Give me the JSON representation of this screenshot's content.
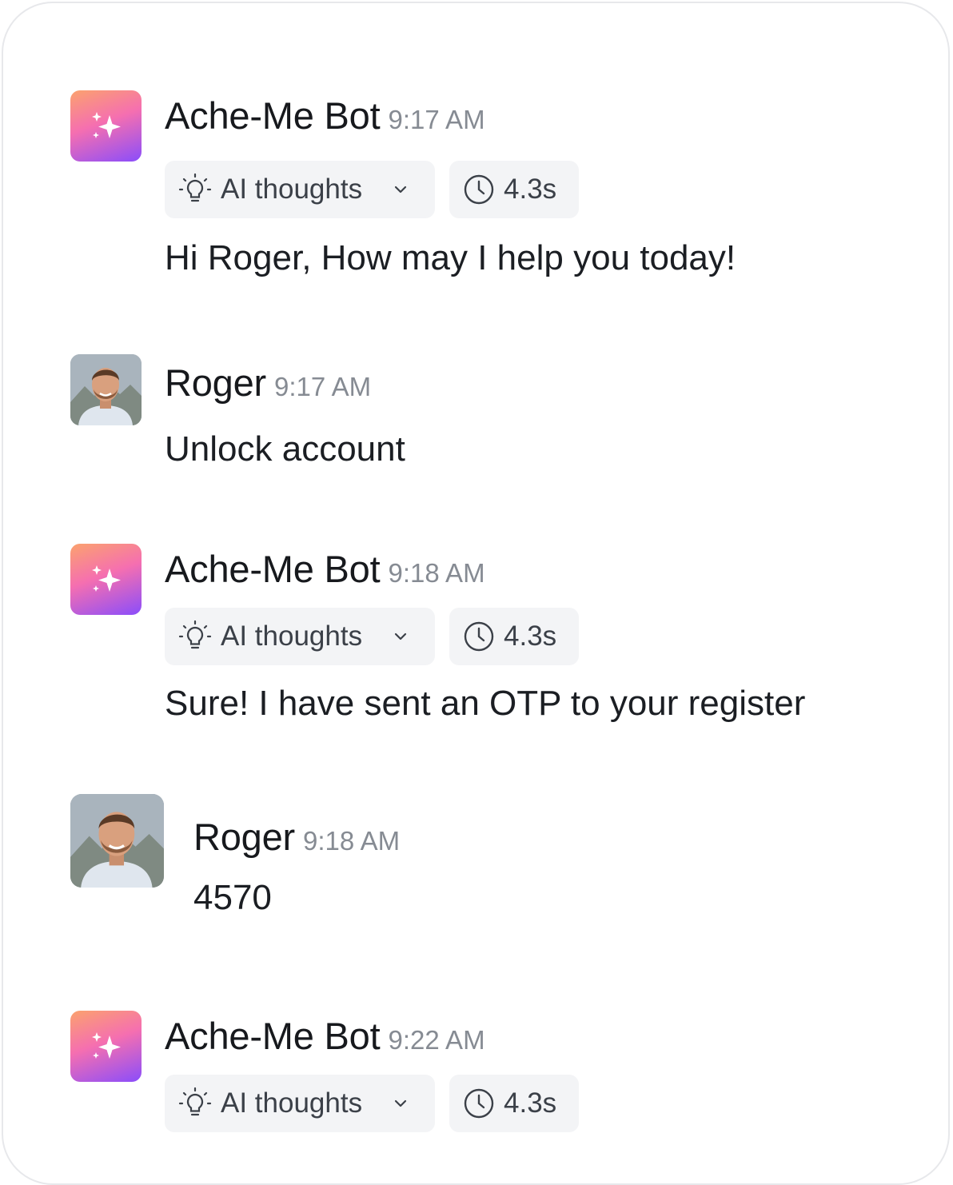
{
  "messages": [
    {
      "author": "Ache-Me Bot",
      "time": "9:17 AM",
      "thoughts_label": "AI thoughts",
      "duration": "4.3s",
      "text": "Hi Roger, How may I help you today!"
    },
    {
      "author": "Roger",
      "time": "9:17 AM",
      "text": "Unlock account"
    },
    {
      "author": "Ache-Me Bot",
      "time": "9:18 AM",
      "thoughts_label": "AI thoughts",
      "duration": "4.3s",
      "text": "Sure! I have sent an OTP to your register"
    },
    {
      "author": "Roger",
      "time": "9:18 AM",
      "text": "4570"
    },
    {
      "author": "Ache-Me Bot",
      "time": "9:22 AM",
      "thoughts_label": "AI thoughts",
      "duration": "4.3s",
      "text": ""
    }
  ],
  "icons": {
    "bot_avatar": "sparkles-icon",
    "thoughts": "lightbulb-icon",
    "thoughts_toggle": "chevron-down-icon",
    "duration": "clock-icon"
  },
  "colors": {
    "bot_gradient": [
      "#fba26e",
      "#f56fb0",
      "#8a4dfb"
    ],
    "chip_background": "#f3f4f6",
    "timestamp": "#868b93"
  }
}
